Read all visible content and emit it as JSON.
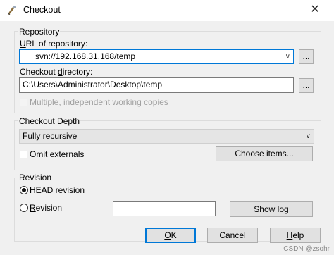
{
  "window": {
    "title": "Checkout",
    "close_glyph": "✕",
    "app_icon": "tortoisesvn-icon"
  },
  "repository": {
    "group_label": "Repository",
    "url_label": "URL of repository:",
    "url_value": "svn://192.168.31.168/temp",
    "url_browse": "...",
    "dir_label": "Checkout directory:",
    "dir_value": "C:\\Users\\Administrator\\Desktop\\temp",
    "dir_browse": "...",
    "multiple_label": "Multiple, independent working copies",
    "multiple_checked": false
  },
  "depth": {
    "group_label": "Checkout Depth",
    "selected": "Fully recursive",
    "omit_label": "Omit externals",
    "omit_checked": false,
    "choose_items": "Choose items..."
  },
  "revision": {
    "group_label": "Revision",
    "head_label": "HEAD revision",
    "head_selected": true,
    "revision_label": "Revision",
    "revision_value": "",
    "show_log": "Show log"
  },
  "buttons": {
    "ok": "OK",
    "cancel": "Cancel",
    "help": "Help"
  },
  "watermark": "CSDN @zsohr"
}
